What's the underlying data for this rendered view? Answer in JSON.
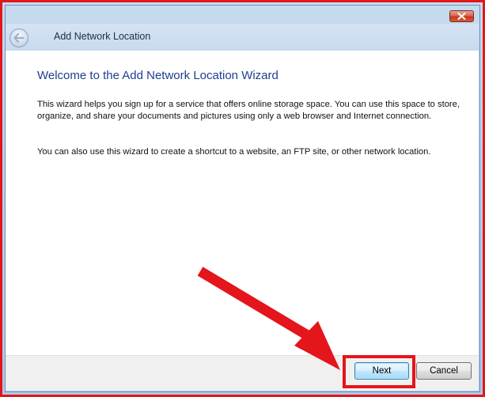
{
  "window": {
    "title": "Add Network Location"
  },
  "content": {
    "heading": "Welcome to the Add Network Location Wizard",
    "paragraph1": "This wizard helps you sign up for a service that offers online storage space.  You can use this space to store, organize, and share your documents and pictures using only a web browser and Internet connection.",
    "paragraph2": "You can also use this wizard to create a shortcut to a website, an FTP site, or other network location."
  },
  "buttons": {
    "next": "Next",
    "cancel": "Cancel"
  },
  "icons": {
    "back": "back-arrow-icon",
    "close": "close-x-icon"
  },
  "colors": {
    "annotation_red": "#e4151b",
    "heading_blue": "#1e3f8d",
    "title_bar": "#b9d1ea"
  }
}
